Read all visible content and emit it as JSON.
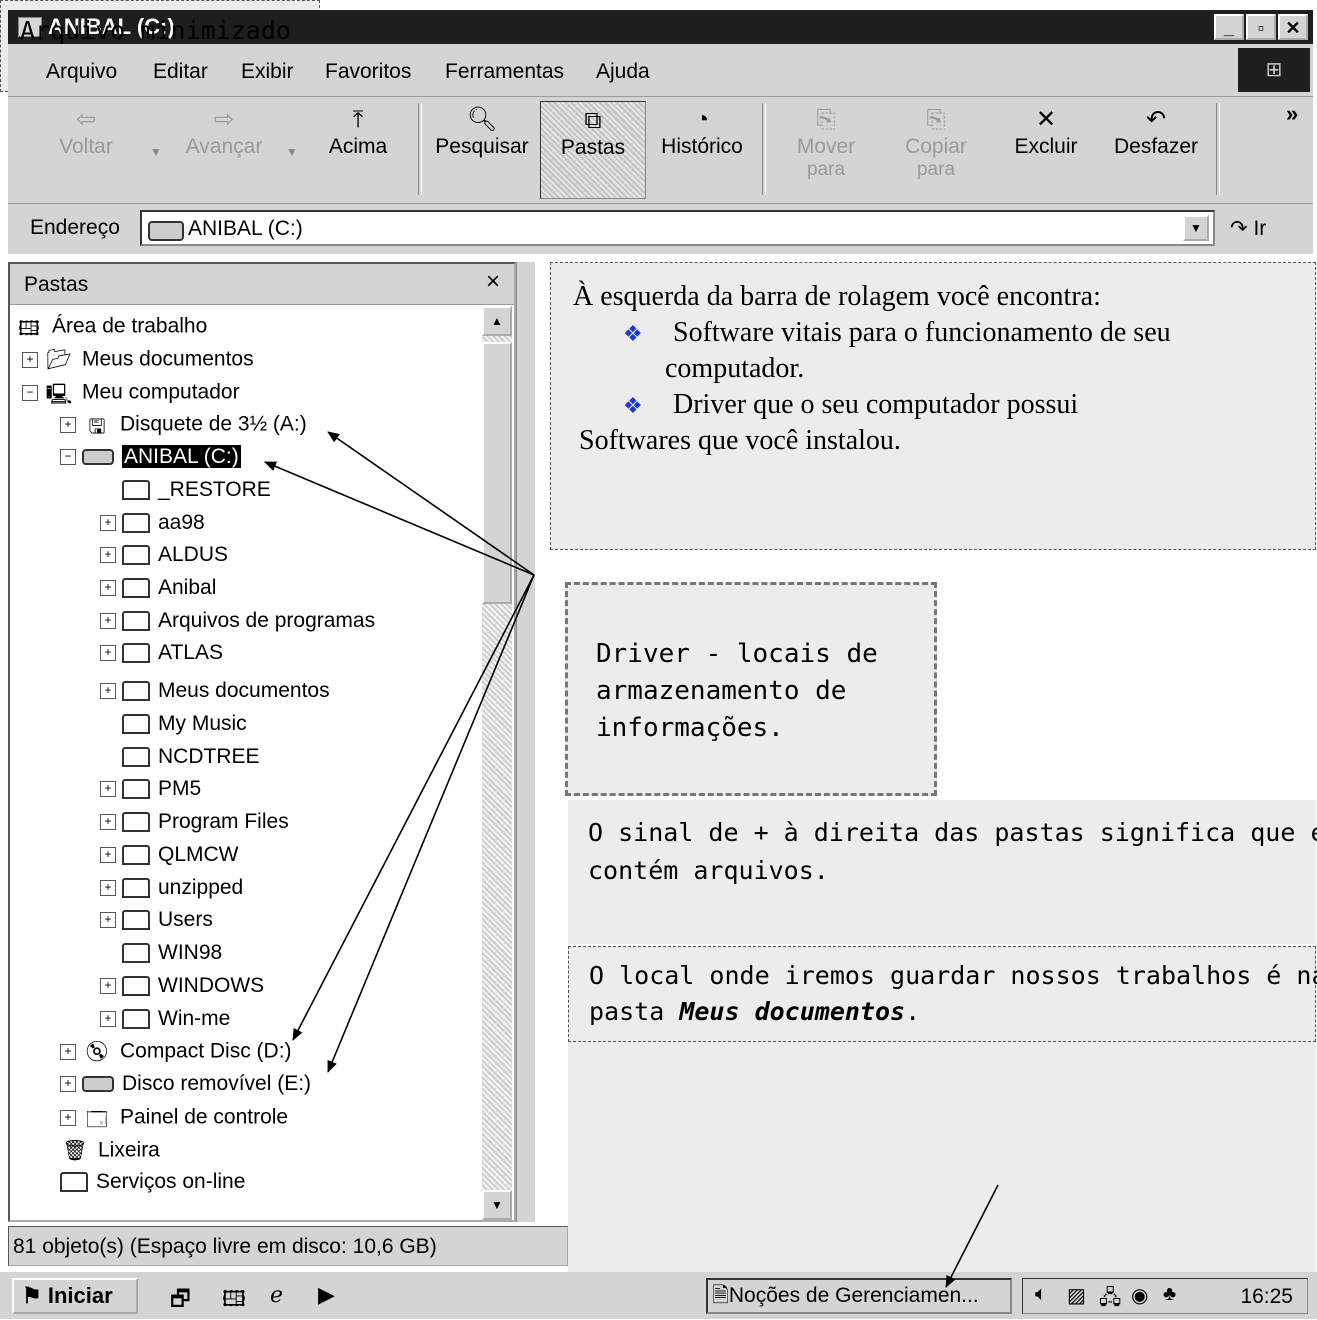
{
  "window": {
    "title": "ANIBAL (C:)",
    "controls": [
      "_",
      "▫",
      "✕"
    ]
  },
  "menu": [
    "Arquivo",
    "Editar",
    "Exibir",
    "Favoritos",
    "Ferramentas",
    "Ajuda"
  ],
  "toolbar": {
    "back": "Voltar",
    "forward": "Avançar",
    "up": "Acima",
    "search": "Pesquisar",
    "folders": "Pastas",
    "history": "Histórico",
    "move_to_1": "Mover",
    "move_to_2": "para",
    "copy_to_1": "Copiar",
    "copy_to_2": "para",
    "delete": "Excluir",
    "undo": "Desfazer",
    "more": "»"
  },
  "address": {
    "label": "Endereço",
    "value": "ANIBAL (C:)",
    "go": "Ir"
  },
  "folders_pane": {
    "title": "Pastas",
    "close": "×",
    "items": [
      "Área de trabalho",
      "Meus documentos",
      "Meu computador",
      "Disquete de 3½ (A:)",
      "ANIBAL (C:)",
      "_RESTORE",
      "aa98",
      "ALDUS",
      "Anibal",
      "Arquivos de programas",
      "ATLAS",
      "Meus documentos",
      "My Music",
      "NCDTREE",
      "PM5",
      "Program Files",
      "QLMCW",
      "unzipped",
      "Users",
      "WIN98",
      "WINDOWS",
      "Win-me",
      "Compact Disc (D:)",
      "Disco removível (E:)",
      "Painel de controle",
      "Lixeira",
      "Serviços on-line"
    ]
  },
  "status": "81 objeto(s) (Espaço livre em disco:  10,6 GB)",
  "taskbar": {
    "start": "Iniciar",
    "task": "Noções de Gerenciamen...",
    "clock": "16:25"
  },
  "notes": {
    "n1": {
      "line1": "À esquerda da barra de rolagem você encontra:",
      "bullet1a": "Software vitais para o funcionamento de seu",
      "bullet1b": "computador.",
      "bullet2": "Driver que o seu computador possui",
      "line4": "Softwares que você instalou."
    },
    "n2": [
      "Driver - locais de",
      "armazenamento de",
      "informações."
    ],
    "n3": [
      "O sinal de + à direita das pastas significa que esta",
      "contém arquivos."
    ],
    "n4": {
      "line1": "O local onde iremos guardar nossos trabalhos é na",
      "prefix": "pasta ",
      "emph": "Meus documentos",
      "suffix": "."
    },
    "n6": "Arquivo minimizado"
  }
}
